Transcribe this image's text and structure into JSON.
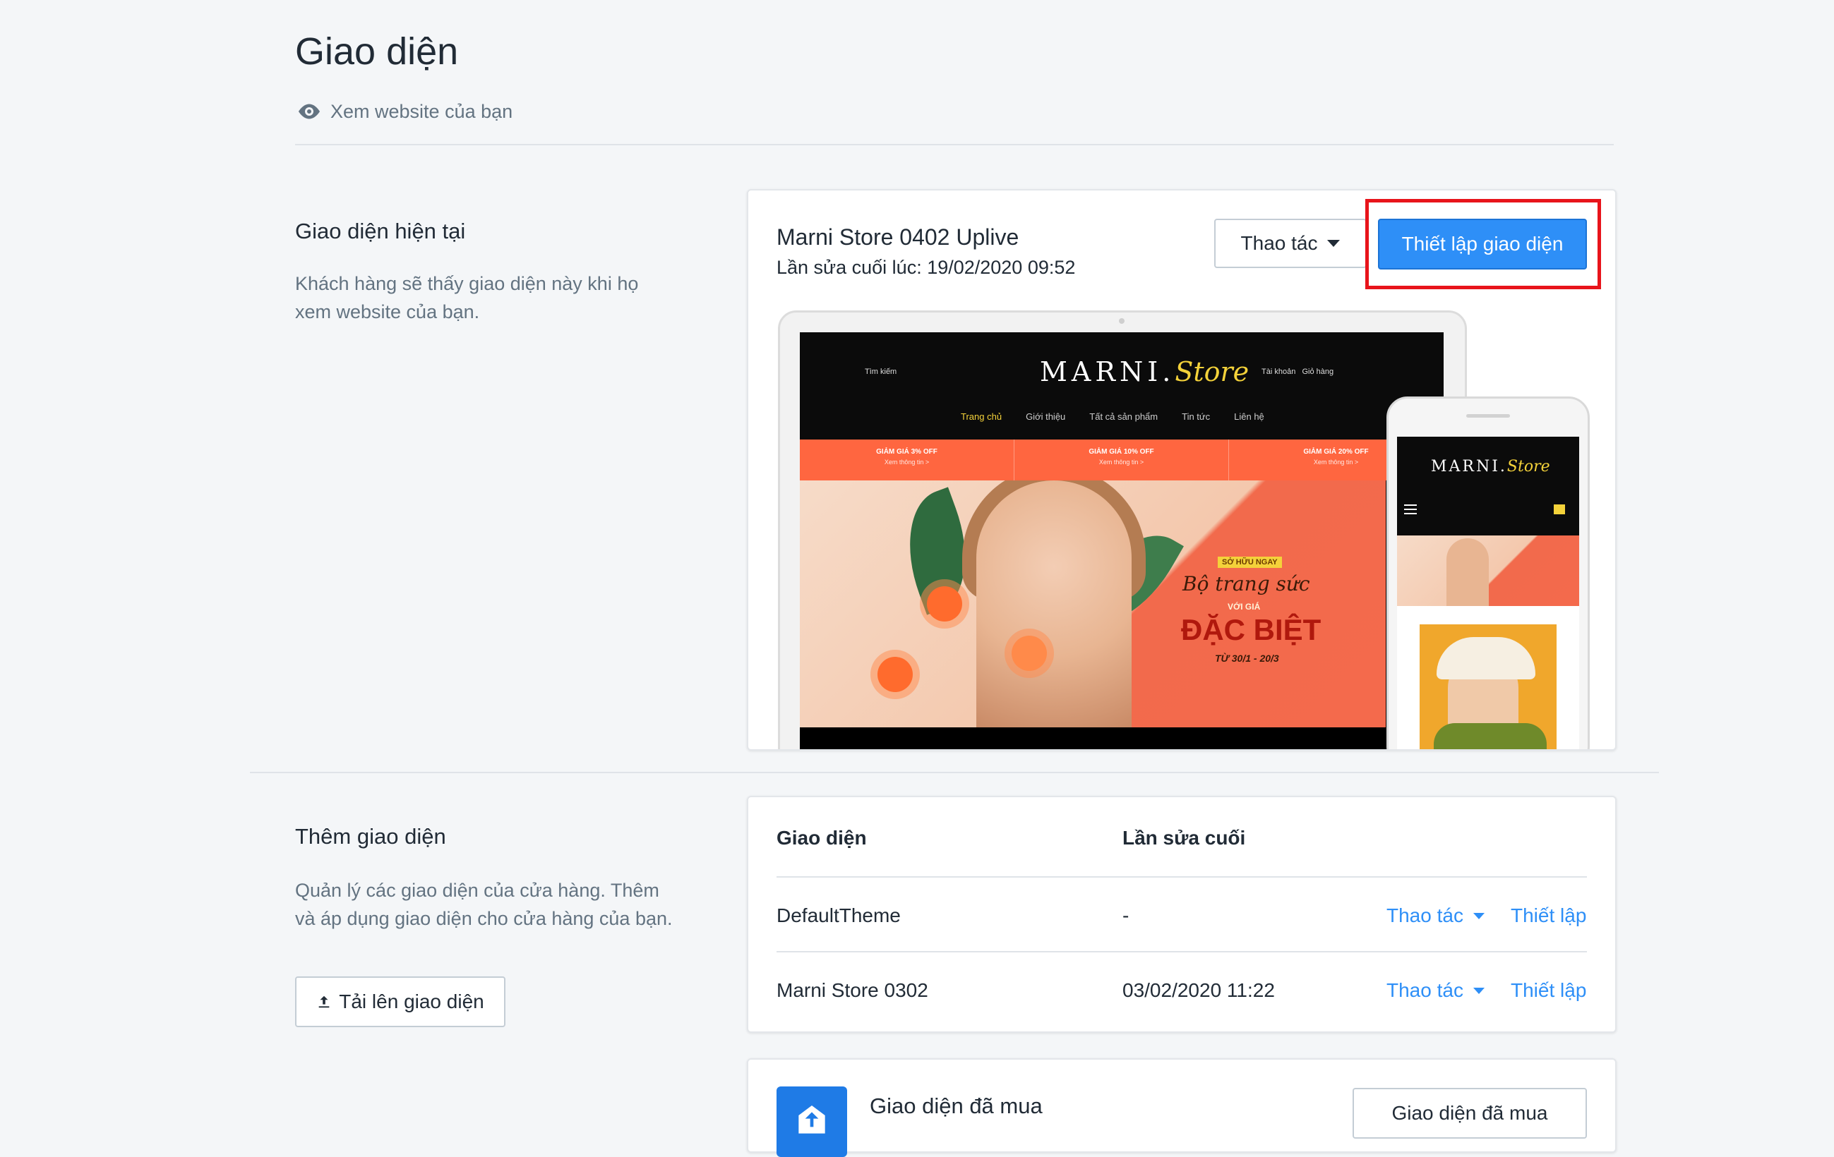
{
  "page": {
    "title": "Giao diện",
    "view_site": "Xem website của bạn"
  },
  "current_section": {
    "title": "Giao diện hiện tại",
    "desc": "Khách hàng sẽ thấy giao diện này khi họ xem website của bạn."
  },
  "current_theme": {
    "name": "Marni Store 0402 Uplive",
    "last_edit": "Lần sửa cuối lúc: 19/02/2020 09:52",
    "actions_label": "Thao tác",
    "setup_label": "Thiết lập giao diện",
    "preview": {
      "search": "Tìm kiếm",
      "logo_main": "MARNI.",
      "logo_store": "Store",
      "account": "Tài khoản",
      "cart": "Giỏ hàng",
      "nav": [
        "Trang chủ",
        "Giới thiệu",
        "Tất cả sản phẩm",
        "Tin tức",
        "Liên hệ"
      ],
      "promos": [
        {
          "title": "GIẢM GIÁ 3% OFF",
          "sub": "Xem thông tin >"
        },
        {
          "title": "GIẢM GIÁ 10% OFF",
          "sub": "Xem thông tin >"
        },
        {
          "title": "GIẢM GIÁ 20% OFF",
          "sub": "Xem thông tin >"
        }
      ],
      "hero_tag": "SỞ HỮU NGAY",
      "hero_line1": "Bộ trang sức",
      "hero_line2": "VỚI GIÁ",
      "hero_line3": "ĐẶC BIỆT",
      "hero_date": "TỪ 30/1 - 20/3"
    }
  },
  "add_section": {
    "title": "Thêm giao diện",
    "desc": "Quản lý các giao diện của cửa hàng. Thêm và áp dụng giao diện cho cửa hàng của bạn.",
    "upload_label": "Tải lên giao diện"
  },
  "themes_table": {
    "headers": [
      "Giao diện",
      "Lần sửa cuối"
    ],
    "rows": [
      {
        "name": "DefaultTheme",
        "last_edit": "-",
        "actions": "Thao tác",
        "setup": "Thiết lập"
      },
      {
        "name": "Marni Store 0302",
        "last_edit": "03/02/2020 11:22",
        "actions": "Thao tác",
        "setup": "Thiết lập"
      }
    ]
  },
  "bought": {
    "title": "Giao diện đã mua",
    "button": "Giao diện đã mua"
  },
  "colors": {
    "primary": "#2e8ff7",
    "highlight": "#e8141b",
    "background": "#f4f6f8",
    "text": "#212b36",
    "muted": "#637381"
  },
  "icons": {
    "view_site": "eye-icon",
    "actions": "caret-down-icon",
    "upload": "upload-icon",
    "bought": "store-icon"
  }
}
